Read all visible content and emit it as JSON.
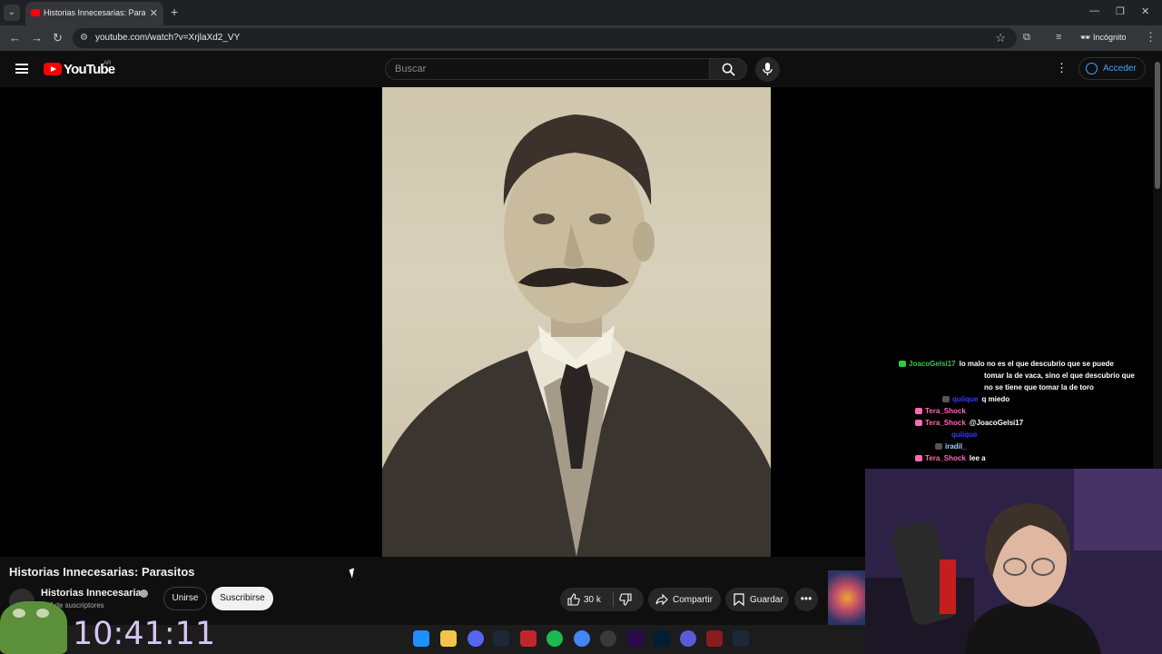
{
  "browser": {
    "tab_title": "Historias Innecesarias: Parasitos",
    "url": "youtube.com/watch?v=XrjlaXd2_VY",
    "profile_label": "Incógnito"
  },
  "youtube": {
    "logo_text": "YouTube",
    "country_code": "AR",
    "search_placeholder": "Buscar",
    "signin_label": "Acceder"
  },
  "video": {
    "title": "Historias Innecesarias: Parasitos",
    "channel_name": "Historias Innecesarias",
    "subscribers": "1 M de suscriptores",
    "join_label": "Unirse",
    "subscribe_label": "Suscribirse",
    "like_count": "30 k",
    "share_label": "Compartir",
    "save_label": "Guardar"
  },
  "chat": {
    "messages": [
      {
        "user": "JoacoGelsi17",
        "text": "lo malo no es el que descubrio que se puede",
        "color": "#2ecc40"
      },
      {
        "user": "",
        "text": "tomar la de vaca, sino el que descubrio que",
        "color": "#ffffff"
      },
      {
        "user": "",
        "text": "no se tiene que tomar la de toro",
        "color": "#ffffff"
      },
      {
        "user": "quiique",
        "text": "q miedo",
        "color": "#3a3aff"
      },
      {
        "user": "Tera_Shock",
        "text": "",
        "color": "#ff69b4"
      },
      {
        "user": "Tera_Shock",
        "text": "@JoacoGelsi17",
        "color": "#ff69b4"
      },
      {
        "user": "quiique",
        "text": "",
        "color": "#3a3aff"
      },
      {
        "user": "iradil_",
        "text": "",
        "color": "#9ad0ff"
      },
      {
        "user": "Tera_Shock",
        "text": "lee a",
        "color": "#ff69b4"
      }
    ]
  },
  "overlay": {
    "clock": "10:41:11"
  },
  "colors": {
    "yt_red": "#ff0000",
    "link_blue": "#3ea6ff",
    "background": "#0f0f0f"
  }
}
